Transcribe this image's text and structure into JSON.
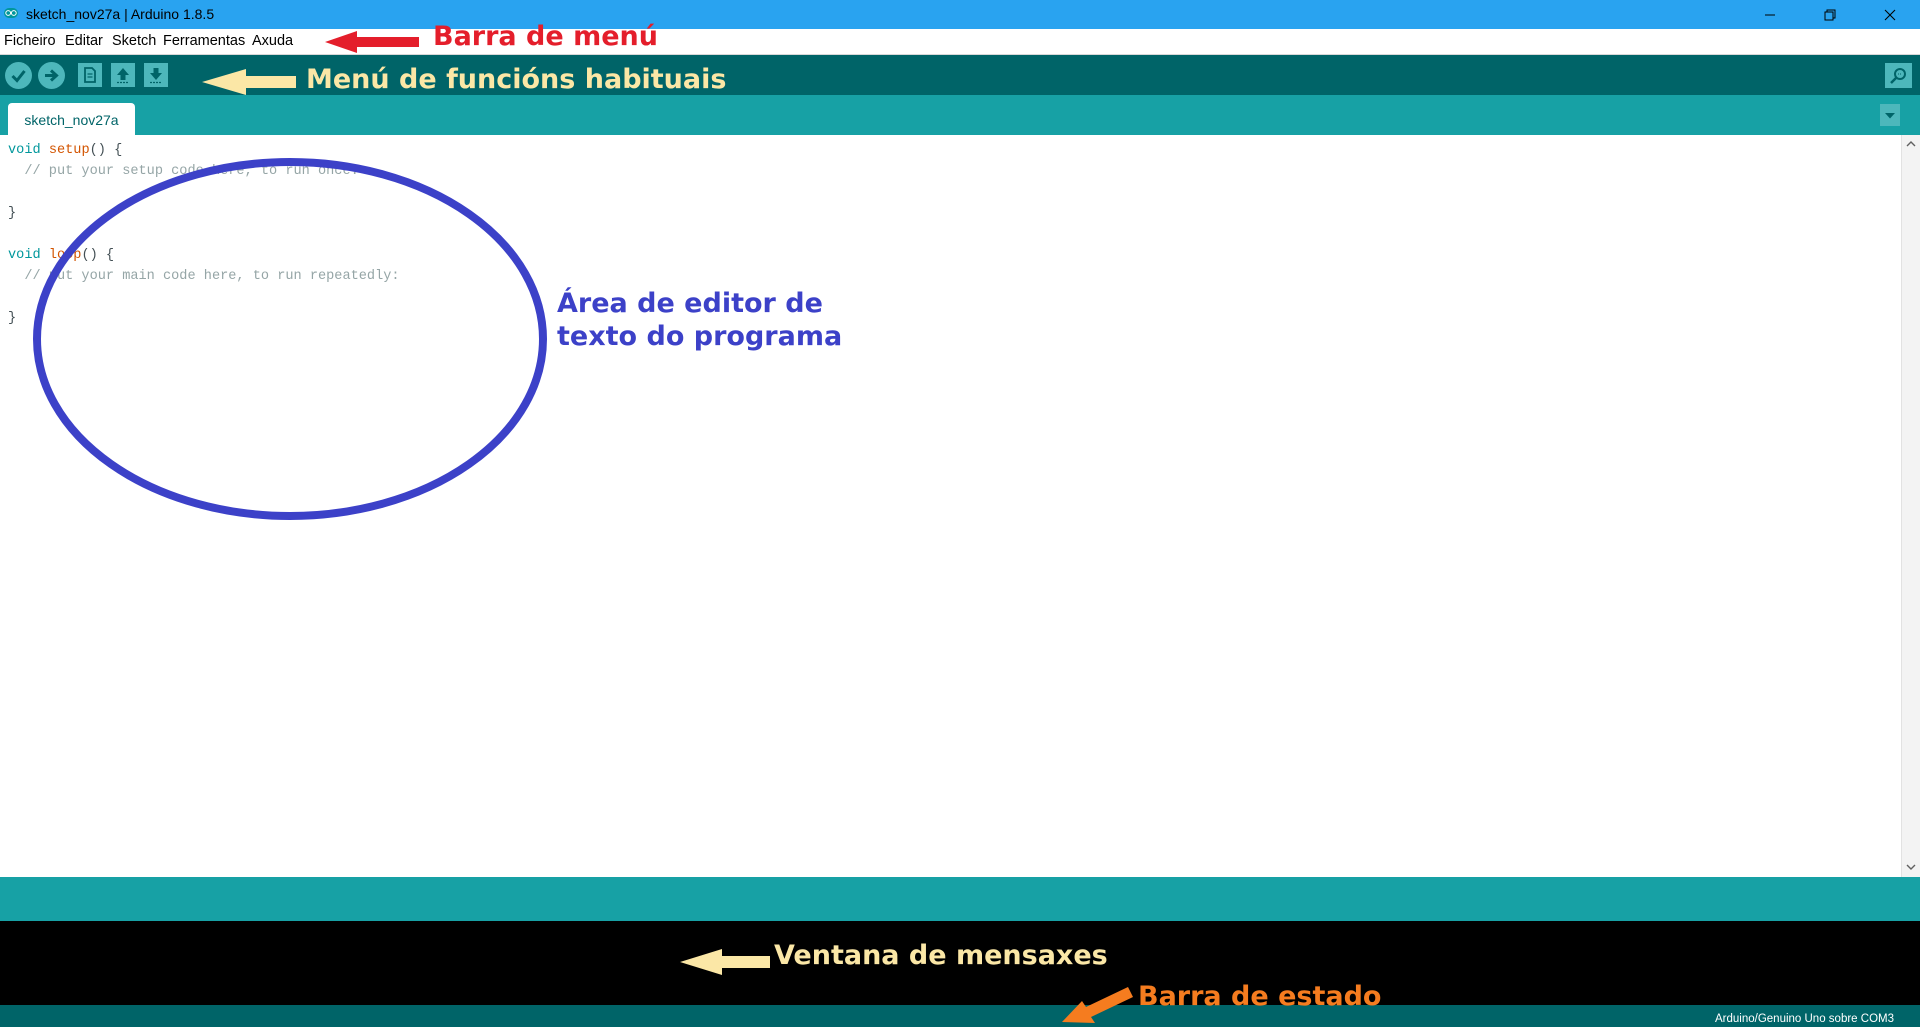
{
  "window": {
    "title": "sketch_nov27a | Arduino 1.8.5",
    "controls": [
      "minimize-icon",
      "restore-icon",
      "close-icon"
    ]
  },
  "menubar": {
    "items": [
      {
        "label": "Ficheiro"
      },
      {
        "label": "Editar"
      },
      {
        "label": "Sketch"
      },
      {
        "label": "Ferramentas"
      },
      {
        "label": "Axuda"
      }
    ]
  },
  "toolbar": {
    "buttons": [
      "verify-icon",
      "upload-icon",
      "new-icon",
      "open-icon",
      "save-icon"
    ],
    "right_button": "serial-monitor-icon"
  },
  "tabs": {
    "active": "sketch_nov27a"
  },
  "editor": {
    "lines": [
      "void setup() {",
      "  // put your setup code here, to run once:",
      "",
      "}",
      "",
      "void loop() {",
      "  // put your main code here, to run repeatedly:",
      "",
      "}"
    ]
  },
  "statusbar": {
    "board": "Arduino/Genuino Uno sobre COM3"
  },
  "annotations": {
    "menu_bar": "Barra de menú",
    "toolbar": "Menú de funcións habituais",
    "editor_line1": "Área de editor de",
    "editor_line2": "texto do programa",
    "messages": "Ventana de mensaxes",
    "status": "Barra de estado"
  },
  "colors": {
    "titlebar": "#29a3f0",
    "toolbar": "#006468",
    "tabbar": "#17a1a5",
    "button": "#4db7bb",
    "console": "#000000",
    "annotation_red": "#e41e2b",
    "annotation_yellow": "#fbe7a6",
    "annotation_blue": "#3c41c8",
    "annotation_orange": "#f57c1f"
  }
}
